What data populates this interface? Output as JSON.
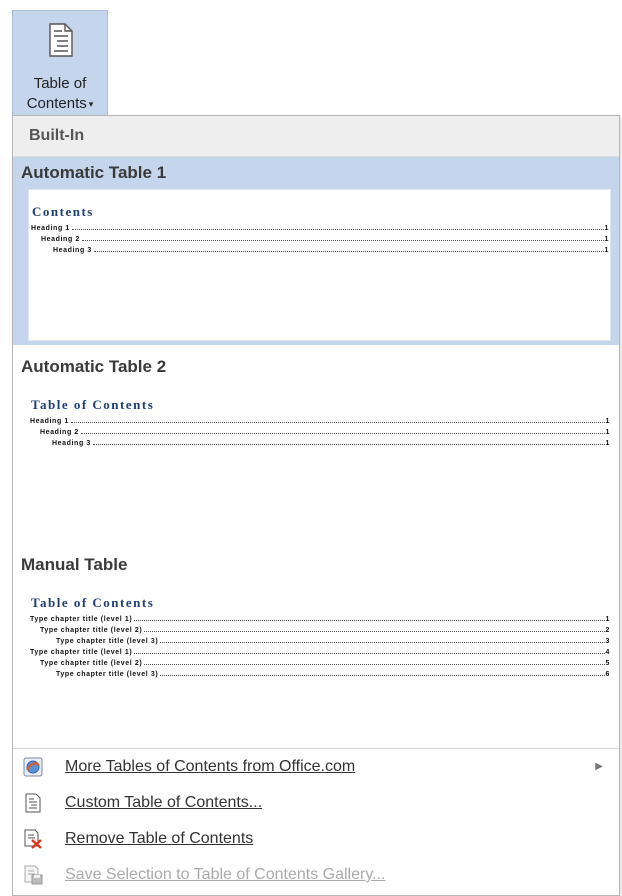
{
  "ribbon": {
    "button_line1": "Table of",
    "button_line2": "Contents",
    "button_arrow": "▾",
    "icon": "document-icon"
  },
  "gallery": {
    "section_header": "Built-In",
    "items": [
      {
        "title": "Automatic Table 1",
        "toc_title": "Contents",
        "lines": [
          {
            "text": "Heading 1",
            "page": "1",
            "level": 1
          },
          {
            "text": "Heading 2",
            "page": "1",
            "level": 2
          },
          {
            "text": "Heading 3",
            "page": "1",
            "level": 3
          }
        ]
      },
      {
        "title": "Automatic Table 2",
        "toc_title": "Table of Contents",
        "lines": [
          {
            "text": "Heading 1",
            "page": "1",
            "level": 1
          },
          {
            "text": "Heading 2",
            "page": "1",
            "level": 2
          },
          {
            "text": "Heading 3",
            "page": "1",
            "level": 3
          }
        ]
      },
      {
        "title": "Manual Table",
        "toc_title": "Table of Contents",
        "lines": [
          {
            "text": "Type chapter title (level 1)",
            "page": "1",
            "level": 1
          },
          {
            "text": "Type chapter title (level 2)",
            "page": "2",
            "level": 2
          },
          {
            "text": "Type chapter title (level 3)",
            "page": "3",
            "level": 3
          },
          {
            "text": "Type chapter title (level 1)",
            "page": "4",
            "level": 1
          },
          {
            "text": "Type chapter title (level 2)",
            "page": "5",
            "level": 2
          },
          {
            "text": "Type chapter title (level 3)",
            "page": "6",
            "level": 3
          }
        ]
      }
    ]
  },
  "menu": [
    {
      "label": "More Tables of Contents from Office.com",
      "icon": "office-globe-icon",
      "submenu": true,
      "enabled": true
    },
    {
      "label": "Custom Table of Contents...",
      "icon": "document-icon",
      "submenu": false,
      "enabled": true
    },
    {
      "label": "Remove Table of Contents",
      "icon": "remove-toc-icon",
      "submenu": false,
      "enabled": true
    },
    {
      "label": "Save Selection to Table of Contents Gallery...",
      "icon": "save-selection-icon",
      "submenu": false,
      "enabled": false
    }
  ],
  "colors": {
    "selection": "#c5d6ec",
    "toc_title": "#1f3f73",
    "header_bg": "#eeeeee"
  }
}
